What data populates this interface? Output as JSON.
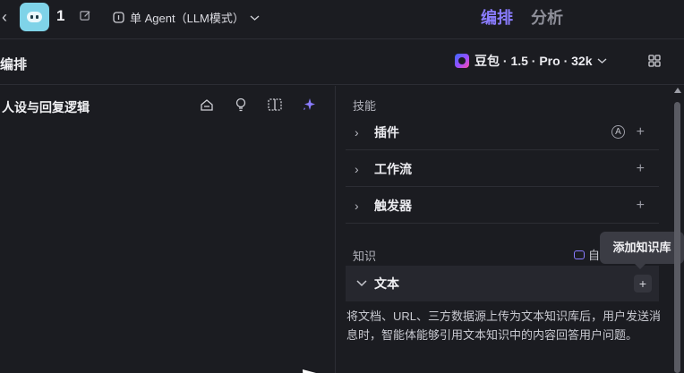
{
  "header": {
    "back_icon": "chevron-left-icon",
    "bot_name": "1",
    "edit_icon": "edit-icon",
    "mode_label": "单 Agent（LLM模式）",
    "tabs": [
      {
        "label": "编排",
        "active": true
      },
      {
        "label": "分析",
        "active": false
      }
    ]
  },
  "subbar": {
    "title": "编排",
    "model_label": "豆包 · 1.5 · Pro · 32k"
  },
  "persona": {
    "title": "人设与回复逻辑",
    "icons": [
      "publish-icon",
      "bulb-icon",
      "compare-icon",
      "sparkle-icon"
    ]
  },
  "skills": {
    "label": "技能",
    "items": [
      {
        "label": "插件",
        "auto": "A"
      },
      {
        "label": "工作流"
      },
      {
        "label": "触发器"
      }
    ]
  },
  "knowledge": {
    "label": "知识",
    "auto_label": "自",
    "text_item": {
      "label": "文本"
    },
    "description": "将文档、URL、三方数据源上传为文本知识库后，用户发送消息时，智能体能够引用文本知识中的内容回答用户问题。",
    "tooltip": "添加知识库"
  },
  "colors": {
    "accent": "#8a7cff",
    "background": "#1b1c21",
    "panel_row": "#26272e"
  }
}
